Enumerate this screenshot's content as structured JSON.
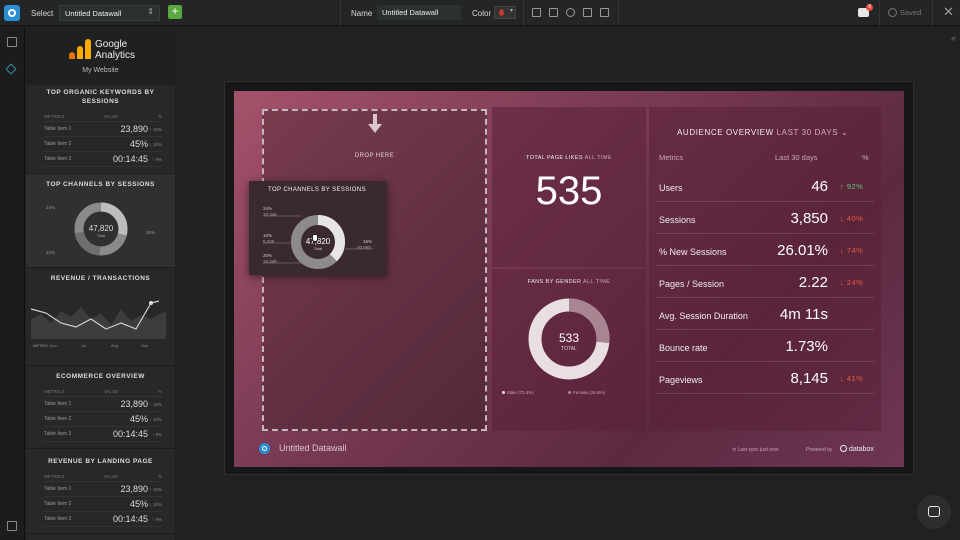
{
  "topbar": {
    "select_label": "Select",
    "select_value": "Untitled Datawall",
    "add_button": "+",
    "name_label": "Name",
    "name_value": "Untitled Datawall",
    "color_label": "Color",
    "notification_count": "9",
    "saved_text": "Saved"
  },
  "library": {
    "source_title_line1": "Google",
    "source_title_line2": "Analytics",
    "site_name": "My Website",
    "keywords": {
      "title": "TOP ORGANIC KEYWORDS BY SESSIONS",
      "head_left": "METRICS",
      "head_mid": "VALUE",
      "head_right": "%",
      "rows": [
        {
          "label": "Table Item 1",
          "value": "23,890",
          "change": "↑ 15%"
        },
        {
          "label": "Table Item 2",
          "value": "45%",
          "change": "↓ 10%"
        },
        {
          "label": "Table Item 3",
          "value": "00:14:45",
          "change": "↑ 9%"
        }
      ]
    },
    "channels": {
      "title": "TOP CHANNELS BY SESSIONS",
      "total": "47,820",
      "total_label": "Total",
      "tags": [
        "24%",
        "10%",
        "20%",
        "16%"
      ]
    },
    "revenue": {
      "title": "REVENUE / TRANSACTIONS",
      "legend": [
        "METRIC 1",
        "METRIC 2"
      ],
      "axis": [
        "Jun",
        "Jul",
        "Aug",
        "Sep",
        "Oct"
      ]
    },
    "ecommerce": {
      "title": "ECOMMERCE OVERVIEW",
      "head_left": "METRICS",
      "head_mid": "VALUE",
      "head_right": "%",
      "rows": [
        {
          "label": "Table Item 1",
          "value": "23,890",
          "change": "↑ 15%"
        },
        {
          "label": "Table Item 2",
          "value": "45%",
          "change": "↓ 10%"
        },
        {
          "label": "Table Item 3",
          "value": "00:14:45",
          "change": "↑ 9%"
        }
      ]
    },
    "landing": {
      "title": "REVENUE BY LANDING PAGE",
      "head_left": "METRICS",
      "head_mid": "VALUE",
      "head_right": "%",
      "rows": [
        {
          "label": "Table Item 1",
          "value": "23,890",
          "change": "↑ 15%"
        },
        {
          "label": "Table Item 2",
          "value": "45%",
          "change": "↓ 10%"
        },
        {
          "label": "Table Item 3",
          "value": "00:14:45",
          "change": "↑ 9%"
        }
      ]
    }
  },
  "canvas": {
    "drop_text": "DROP HERE",
    "dragging": {
      "title": "TOP CHANNELS BY SESSIONS",
      "total": "47,820",
      "total_label": "Total",
      "tags": [
        {
          "pct": "24%",
          "num": "10,348"
        },
        {
          "pct": "10%",
          "num": "5,346"
        },
        {
          "pct": "20%",
          "num": "10,345"
        },
        {
          "pct": "16%",
          "num": "20,560"
        }
      ]
    },
    "page_likes": {
      "title": "TOTAL PAGE LIKES",
      "period": "ALL TIME",
      "value": "535"
    },
    "fans": {
      "title": "FANS BY GENDER",
      "period": "ALL TIME",
      "total": "533",
      "total_label": "TOTAL",
      "male_label": "Male (73.4%)",
      "female_label": "Female (26.6%)",
      "male_fraction": 0.734,
      "female_fraction": 0.266
    },
    "audience": {
      "title": "AUDIENCE OVERVIEW",
      "period": "LAST 30 DAYS",
      "col_metrics": "Metrics",
      "col_value": "Last 30 days",
      "col_pct": "%",
      "rows": [
        {
          "name": "Users",
          "value": "46",
          "change": "↑ 92%",
          "dir": "up"
        },
        {
          "name": "Sessions",
          "value": "3,850",
          "change": "↓ 40%",
          "dir": "down"
        },
        {
          "name": "% New Sessions",
          "value": "26.01%",
          "change": "↓ 74%",
          "dir": "down"
        },
        {
          "name": "Pages / Session",
          "value": "2.22",
          "change": "↓ 24%",
          "dir": "down"
        },
        {
          "name": "Avg. Session Duration",
          "value": "4m 11s",
          "change": "",
          "dir": "none"
        },
        {
          "name": "Bounce rate",
          "value": "1.73%",
          "change": "",
          "dir": "none"
        },
        {
          "name": "Pageviews",
          "value": "8,145",
          "change": "↓ 41%",
          "dir": "down"
        }
      ]
    },
    "footer": {
      "name": "Untitled Datawall",
      "sync_text": "Last sync just now",
      "powered": "Powered by",
      "brand": "databox"
    }
  }
}
